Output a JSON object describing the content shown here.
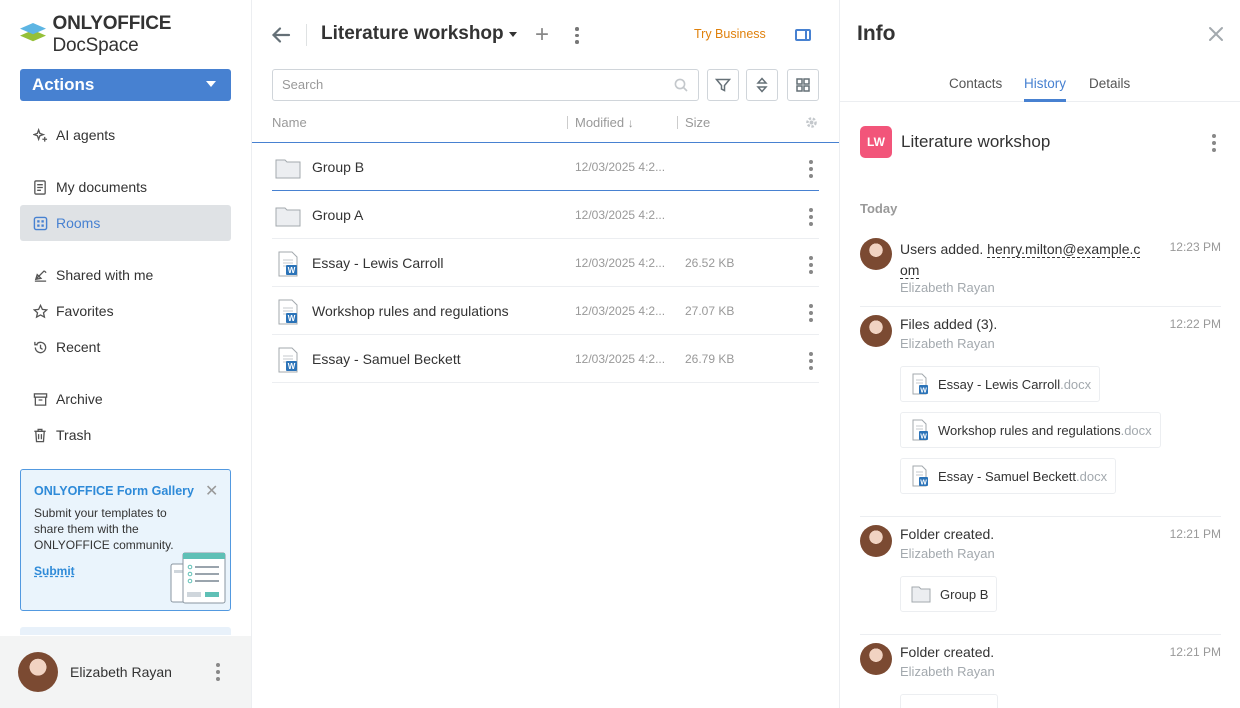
{
  "sidebar": {
    "logo_brand": "ONLYOFFICE",
    "logo_product": "DocSpace",
    "actions_label": "Actions",
    "items": [
      {
        "label": "AI agents",
        "icon": "sparkle-icon"
      },
      {
        "label": "My documents",
        "icon": "document-icon"
      },
      {
        "label": "Rooms",
        "icon": "rooms-icon",
        "active": true
      },
      {
        "label": "Shared with me",
        "icon": "shared-icon"
      },
      {
        "label": "Favorites",
        "icon": "star-icon"
      },
      {
        "label": "Recent",
        "icon": "clock-icon"
      },
      {
        "label": "Archive",
        "icon": "archive-icon"
      },
      {
        "label": "Trash",
        "icon": "trash-icon"
      }
    ],
    "gallery": {
      "title": "ONLYOFFICE Form Gallery",
      "text": "Submit your templates to share them with the ONLYOFFICE community.",
      "link": "Submit"
    },
    "user": {
      "name": "Elizabeth Rayan"
    }
  },
  "header": {
    "room_title": "Literature workshop",
    "try_business": "Try Business"
  },
  "search": {
    "placeholder": "Search"
  },
  "columns": {
    "name": "Name",
    "modified": "Modified",
    "size": "Size"
  },
  "files": [
    {
      "name": "Group B",
      "type": "folder",
      "modified": "12/03/2025 4:2...",
      "size": ""
    },
    {
      "name": "Group A",
      "type": "folder",
      "modified": "12/03/2025 4:2...",
      "size": ""
    },
    {
      "name": "Essay - Lewis Carroll",
      "type": "docx",
      "modified": "12/03/2025 4:2...",
      "size": "26.52 KB"
    },
    {
      "name": "Workshop rules and regulations",
      "type": "docx",
      "modified": "12/03/2025 4:2...",
      "size": "27.07 KB"
    },
    {
      "name": "Essay - Samuel Beckett",
      "type": "docx",
      "modified": "12/03/2025 4:2...",
      "size": "26.79 KB"
    }
  ],
  "info": {
    "title": "Info",
    "tabs": [
      "Contacts",
      "History",
      "Details"
    ],
    "active_tab": "History",
    "room_badge": "LW",
    "room_name": "Literature workshop",
    "today_label": "Today",
    "history": [
      {
        "title": "Users added.",
        "email_part1": "henry.milton@example.c",
        "email_part2": "om",
        "author": "Elizabeth Rayan",
        "time": "12:23 PM"
      },
      {
        "title": "Files added (3).",
        "author": "Elizabeth Rayan",
        "time": "12:22 PM",
        "files": [
          {
            "name": "Essay - Lewis Carroll",
            "ext": ".docx"
          },
          {
            "name": "Workshop rules and regulations",
            "ext": ".docx"
          },
          {
            "name": "Essay - Samuel Beckett",
            "ext": ".docx"
          }
        ]
      },
      {
        "title": "Folder created.",
        "author": "Elizabeth Rayan",
        "time": "12:21 PM",
        "folder": "Group B"
      },
      {
        "title": "Folder created.",
        "author": "Elizabeth Rayan",
        "time": "12:21 PM"
      }
    ]
  },
  "colors": {
    "accent": "#4781d1",
    "room_badge": "#f2557a",
    "try_business": "#e0810c",
    "active_nav_bg": "#dfe2e5"
  }
}
